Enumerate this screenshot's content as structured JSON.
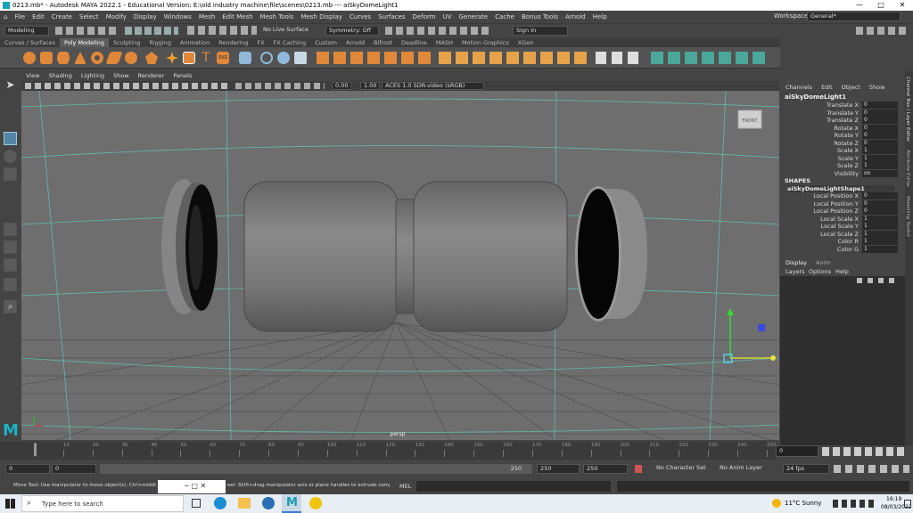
{
  "title": "0213.mb* - Autodesk MAYA 2022.1 - Educational Version: E:\\old industry machine\\file\\scenes\\0213.mb  ---  aiSkyDomeLight1",
  "window_controls": {
    "minimize": "—",
    "maximize": "□",
    "close": "✕"
  },
  "menus": [
    "File",
    "Edit",
    "Create",
    "Select",
    "Modify",
    "Display",
    "Windows",
    "Mesh",
    "Edit Mesh",
    "Mesh Tools",
    "Mesh Display",
    "Curves",
    "Surfaces",
    "Deform",
    "UV",
    "Generate",
    "Cache",
    "Bonus Tools",
    "Arnold",
    "Help"
  ],
  "workspace": {
    "label": "Workspace :",
    "value": "General*"
  },
  "status": {
    "menuset": "Modeling",
    "live": "No Live Surface",
    "symmetry": "Symmetry: Off",
    "signin": "Sign In"
  },
  "shelf_tabs": [
    "Curves / Surfaces",
    "Poly Modeling",
    "Sculpting",
    "Rigging",
    "Animation",
    "Rendering",
    "FX",
    "FX Caching",
    "Custom",
    "Arnold",
    "Bifrost",
    "Deadline",
    "MASH",
    "Motion Graphics",
    "XGen"
  ],
  "shelf_active": "Poly Modeling",
  "panel_menu": [
    "View",
    "Shading",
    "Lighting",
    "Show",
    "Renderer",
    "Panels"
  ],
  "panel_fields": {
    "near": "0.00",
    "far": "1.00",
    "colorspace": "ACES 1.0 SDR-video (sRGB)"
  },
  "viewport": {
    "camera": "persp",
    "viewcube": "FRONT"
  },
  "channel_box": {
    "menu": [
      "Channels",
      "Edit",
      "Object",
      "Show"
    ],
    "object": "aiSkyDomeLight1",
    "attrs": [
      {
        "label": "Translate X",
        "value": "0"
      },
      {
        "label": "Translate Y",
        "value": "0"
      },
      {
        "label": "Translate Z",
        "value": "0"
      },
      {
        "label": "Rotate X",
        "value": "0"
      },
      {
        "label": "Rotate Y",
        "value": "0"
      },
      {
        "label": "Rotate Z",
        "value": "0"
      },
      {
        "label": "Scale X",
        "value": "1"
      },
      {
        "label": "Scale Y",
        "value": "1"
      },
      {
        "label": "Scale Z",
        "value": "1"
      },
      {
        "label": "Visibility",
        "value": "on"
      }
    ],
    "shapes_header": "SHAPES",
    "shape": "aiSkyDomeLightShape1",
    "shape_attrs": [
      {
        "label": "Local Position X",
        "value": "0"
      },
      {
        "label": "Local Position Y",
        "value": "0"
      },
      {
        "label": "Local Position Z",
        "value": "0"
      },
      {
        "label": "Local Scale X",
        "value": "1"
      },
      {
        "label": "Local Scale Y",
        "value": "1"
      },
      {
        "label": "Local Scale Z",
        "value": "1"
      },
      {
        "label": "Color R",
        "value": "1"
      },
      {
        "label": "Color G",
        "value": "1"
      }
    ]
  },
  "layer_editor": {
    "tabs": [
      "Display",
      "Anim"
    ],
    "menu": [
      "Layers",
      "Options",
      "Help"
    ]
  },
  "side_tabs": [
    "Channel Box / Layer Editor",
    "Attribute Editor",
    "Modelling Toolkit"
  ],
  "timeline": {
    "ticks": [
      "0",
      "10",
      "20",
      "30",
      "40",
      "50",
      "60",
      "70",
      "80",
      "90",
      "100",
      "110",
      "120",
      "130",
      "140",
      "150",
      "160",
      "170",
      "180",
      "190",
      "200",
      "210",
      "220",
      "230",
      "240",
      "250"
    ],
    "current": "0"
  },
  "range": {
    "start": "0",
    "start2": "0",
    "end_inner": "250",
    "end_outer": "250",
    "end2": "250",
    "character": "No Character Set",
    "anim_layer": "No Anim Layer",
    "fps": "24 fps"
  },
  "command": {
    "help": "Move Tool: Use manipulator to move object(s). Ctrl+middle-drag",
    "help2": "eel: Shift+drag manipulator axis or plane handles to extrude components or c",
    "mel": "MEL"
  },
  "taskbar": {
    "search": "Type here to search",
    "weather": "11°C  Sunny",
    "time": "16:19",
    "date": "08/03/2022"
  }
}
